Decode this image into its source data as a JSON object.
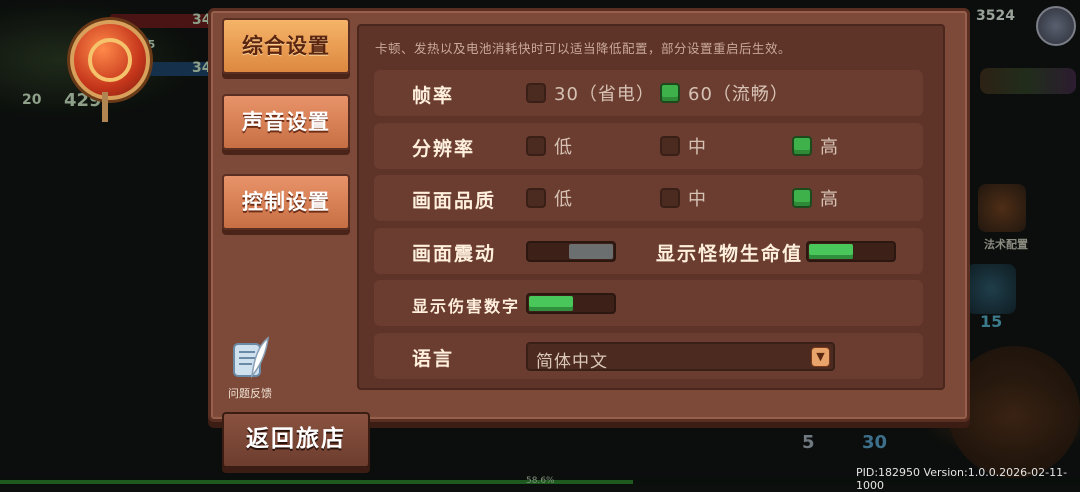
{
  "hud": {
    "bar_value_1": "34",
    "bar_value_2": "35",
    "bar_value_3": "34",
    "level": "20",
    "gold_fragment": "429",
    "top_right_score": "3524",
    "side_right_label": "法术配置",
    "side_right_count": "15",
    "bottom_count_1": "5",
    "bottom_count_2": "30",
    "progress_label": "58.6%",
    "progress_fraction": 0.586
  },
  "tabs": [
    {
      "label": "综合设置",
      "active": true
    },
    {
      "label": "声音设置",
      "active": false
    },
    {
      "label": "控制设置",
      "active": false
    }
  ],
  "notice": "卡顿、发热以及电池消耗快时可以适当降低配置，部分设置重启后生效。",
  "settings": {
    "framerate": {
      "label": "帧率",
      "options": [
        {
          "label": "30（省电）",
          "checked": false
        },
        {
          "label": "60（流畅）",
          "checked": true
        }
      ]
    },
    "resolution": {
      "label": "分辨率",
      "options": [
        {
          "label": "低",
          "checked": false
        },
        {
          "label": "中",
          "checked": false
        },
        {
          "label": "高",
          "checked": true
        }
      ]
    },
    "quality": {
      "label": "画面品质",
      "options": [
        {
          "label": "低",
          "checked": false
        },
        {
          "label": "中",
          "checked": false
        },
        {
          "label": "高",
          "checked": true
        }
      ]
    },
    "screen_shake": {
      "label": "画面震动",
      "enabled": false
    },
    "monster_hp": {
      "label": "显示怪物生命值",
      "enabled": true
    },
    "damage_numbers": {
      "label": "显示伤害数字",
      "enabled": true
    },
    "language": {
      "label": "语言",
      "value": "简体中文"
    }
  },
  "feedback": {
    "label": "问题反馈"
  },
  "back_button": {
    "label": "返回旅店"
  },
  "footer": {
    "version": "PID:182950  Version:1.0.0.2026-02-11-1000"
  },
  "colors": {
    "panel": "#7d4a3a",
    "checked_green": "#3fb14a",
    "tab_active": "#f5b468",
    "tab_inactive": "#e9936a"
  }
}
